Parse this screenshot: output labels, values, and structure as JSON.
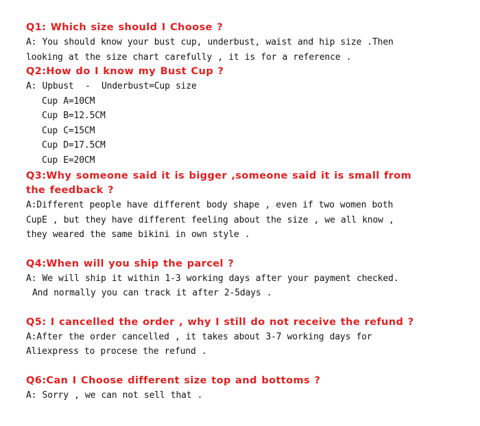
{
  "document": {
    "type": "faq",
    "title_color": "#e02020",
    "body_color": "#141414",
    "background": "#ffffff",
    "items": [
      {
        "id": "q1",
        "question": "Q1: Which size should I Choose ?",
        "answer_lines": [
          "A: You should know your bust cup, underbust, waist and hip size .Then looking at the size chart carefully , it is for a reference ."
        ]
      },
      {
        "id": "q2",
        "question": "Q2:How do I know my Bust Cup ?",
        "answer_lines": [
          "A: Upbust  -  Underbust=Cup size"
        ],
        "cup_lines": [
          "Cup A=10CM",
          "Cup B=12.5CM",
          "Cup C=15CM",
          "Cup D=17.5CM",
          "Cup E=20CM"
        ]
      },
      {
        "id": "q3",
        "question": "Q3:Why  someone  said  it  is  bigger  ,someone  said  it  is  small  from  the  feedback ?",
        "answer_lines": [
          "A:Different people have different body shape , even if two women both CupE , but they have different feeling about the size , we all know , they weared the same bikini in own style ."
        ]
      },
      {
        "id": "q4",
        "question": "Q4:When will you ship the parcel ?",
        "answer_lines": [
          "A: We will ship it within 1-3 working days after your payment checked."
        ],
        "indented_lines": [
          "And normally you can track it after 2-5days ."
        ]
      },
      {
        "id": "q5",
        "question": "Q5: I cancelled the order , why I still do not receive the refund ?",
        "answer_lines": [
          "A:After the order cancelled , it takes about 3-7 working days for Aliexpress to procese the refund ."
        ]
      },
      {
        "id": "q6",
        "question": "Q6:Can I Choose different size top and bottoms ?",
        "answer_lines": [
          "A: Sorry , we can not sell that ."
        ]
      }
    ]
  }
}
